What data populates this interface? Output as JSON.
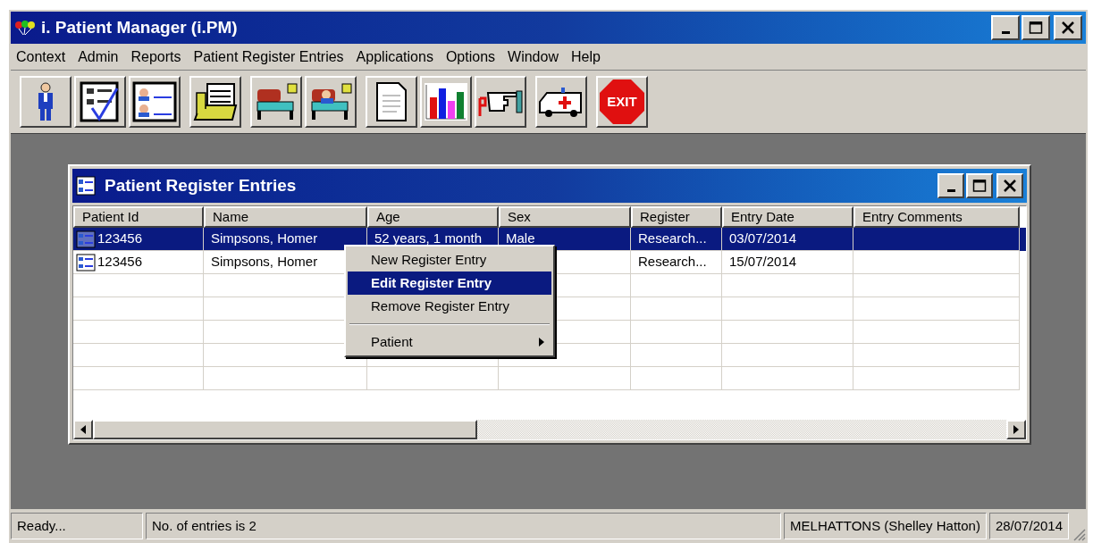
{
  "window": {
    "title": "i. Patient Manager (i.PM)"
  },
  "menu_bar": [
    "Context",
    "Admin",
    "Reports",
    "Patient Register Entries",
    "Applications",
    "Options",
    "Window",
    "Help"
  ],
  "toolbar": [
    [
      {
        "kind": "person"
      },
      {
        "kind": "checklist"
      },
      {
        "kind": "cards"
      }
    ],
    [
      {
        "kind": "folder"
      }
    ],
    [
      {
        "kind": "bed"
      },
      {
        "kind": "patient_bed"
      }
    ],
    [
      {
        "kind": "document"
      },
      {
        "kind": "chart"
      },
      {
        "kind": "hand"
      }
    ],
    [
      {
        "kind": "ambulance"
      }
    ],
    [
      {
        "kind": "exit",
        "label": "EXIT"
      }
    ]
  ],
  "child_window": {
    "title": "Patient Register Entries"
  },
  "table": {
    "columns": [
      "Patient Id",
      "Name",
      "Age",
      "Sex",
      "Register",
      "Entry Date",
      "Entry Comments"
    ],
    "rows": [
      {
        "selected": true,
        "patient_id": "123456",
        "name": "Simpsons, Homer",
        "age": "52 years, 1 month",
        "sex": "Male",
        "register": "Research...",
        "entry_date": "03/07/2014"
      },
      {
        "selected": false,
        "patient_id": "123456",
        "name": "Simpsons, Homer",
        "register": "Research...",
        "entry_date": "15/07/2014"
      }
    ]
  },
  "context_menu": {
    "items": [
      {
        "kind": "item",
        "label": "New Register Entry",
        "selected": false
      },
      {
        "kind": "item",
        "label": "Edit Register Entry",
        "selected": true
      },
      {
        "kind": "item",
        "label": "Remove Register Entry",
        "selected": false
      },
      {
        "kind": "separator"
      },
      {
        "kind": "submenu",
        "label": "Patient",
        "selected": false
      }
    ]
  },
  "status_bar": [
    "Ready...",
    "No. of entries is 2",
    "MELHATTONS (Shelley Hatton)",
    "28/07/2014"
  ]
}
